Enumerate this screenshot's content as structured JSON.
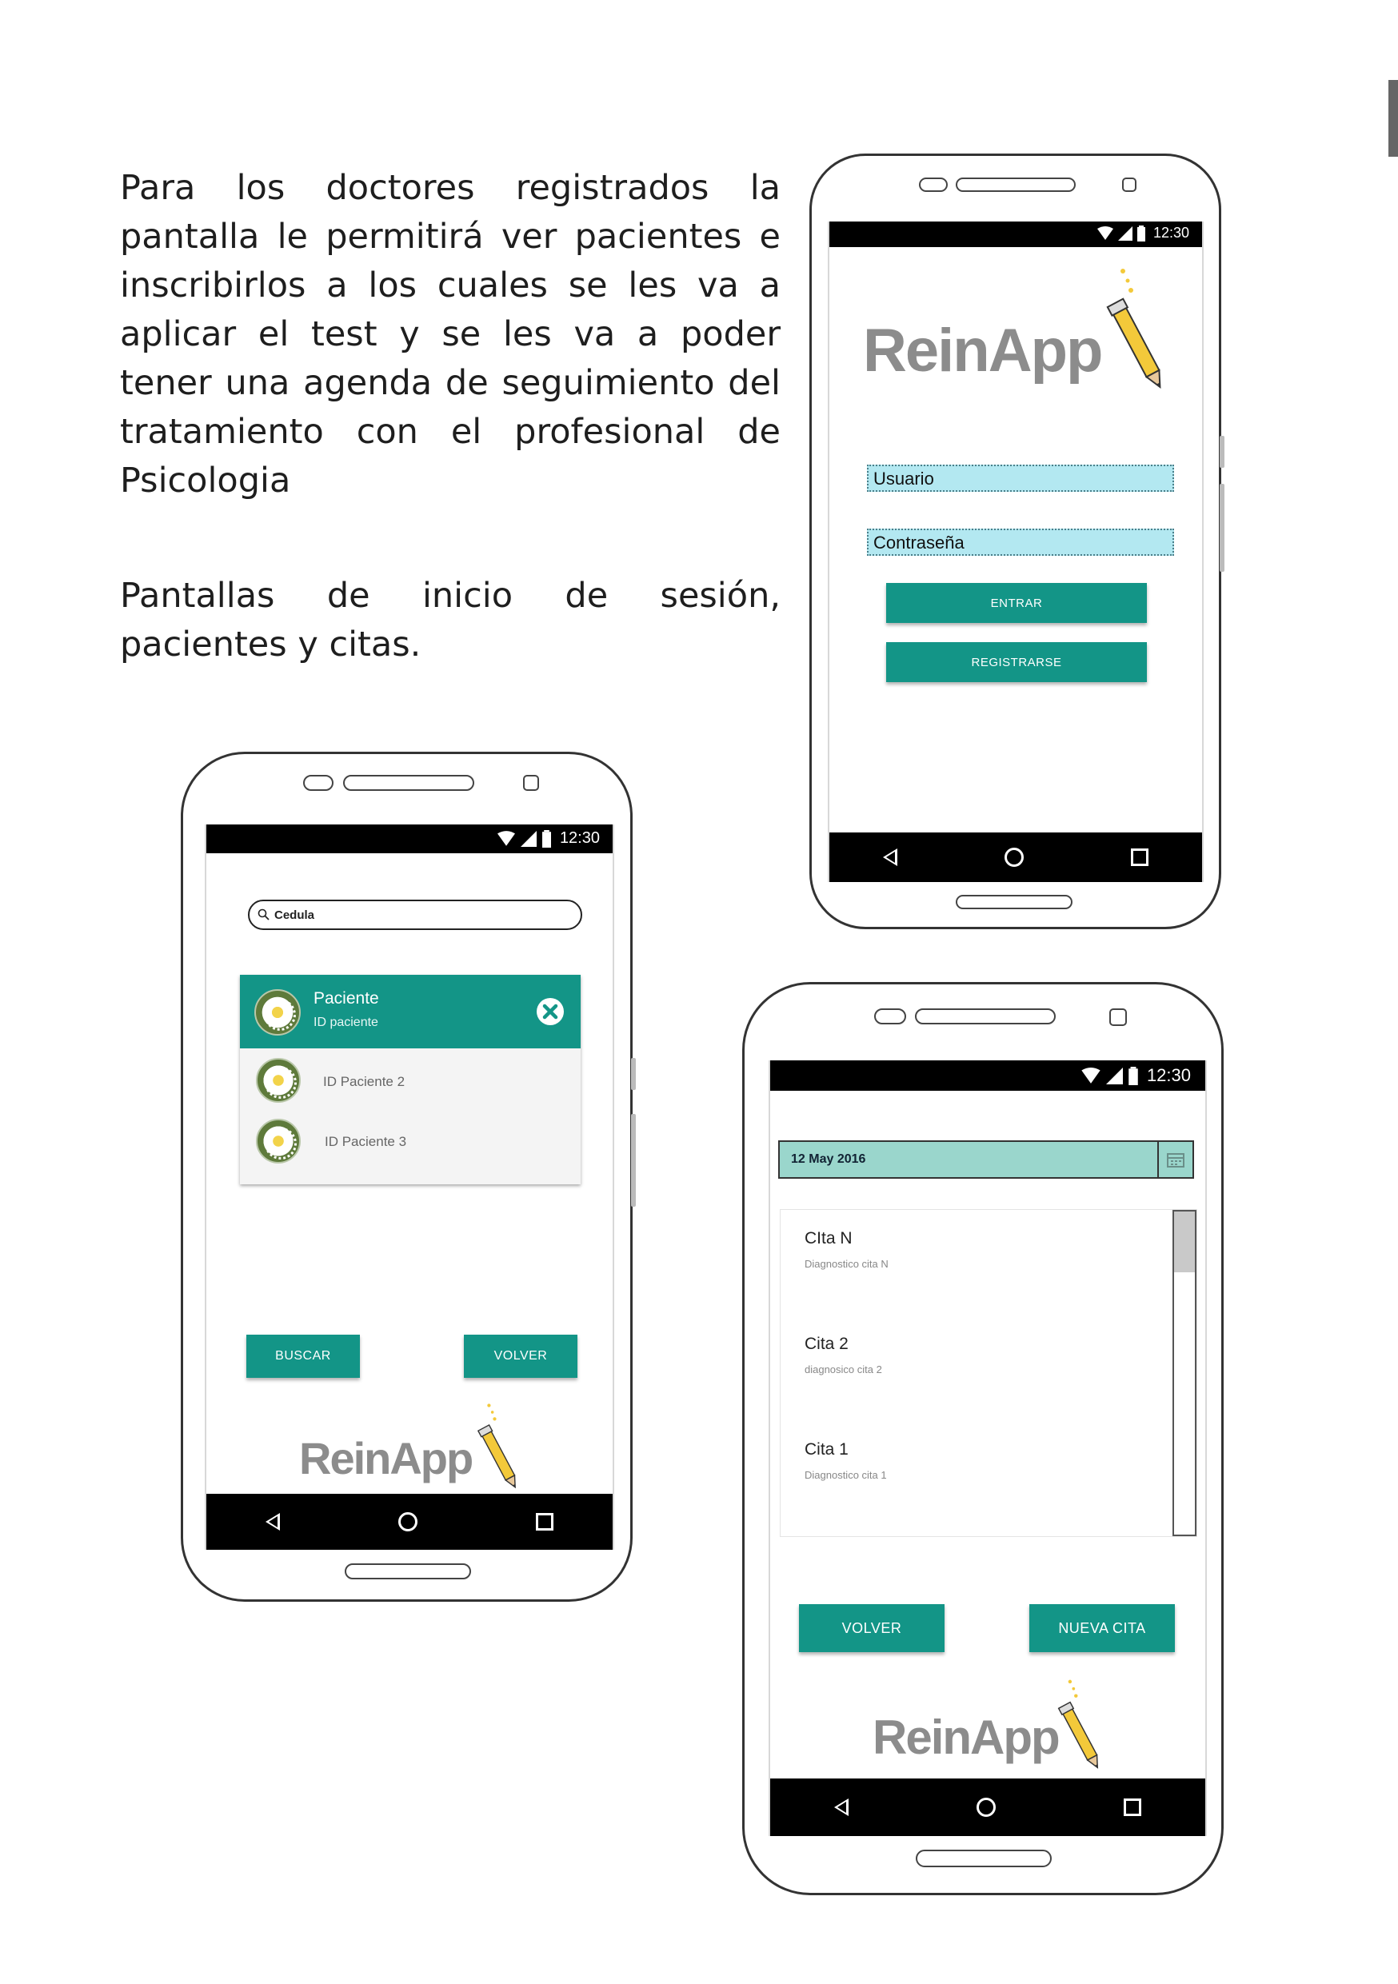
{
  "text": {
    "paragraph_1": "Para los doctores registrados la pantalla le permitirá ver pacientes e inscribirlos a los cuales se les va a aplicar el test y se les va a poder tener una agenda de seguimiento del tratamiento con el profesional de Psicologia",
    "paragraph_2": "Pantallas de inicio de sesión, pacientes y citas."
  },
  "status_bar": {
    "time": "12:30"
  },
  "logo": {
    "text": "ReinApp"
  },
  "login_screen": {
    "username_field": "Usuario",
    "password_field": "Contraseña",
    "enter_button": "ENTRAR",
    "register_button": "REGISTRARSE"
  },
  "patients_screen": {
    "search_placeholder": "Cedula",
    "selected_patient": {
      "name": "Paciente",
      "id": "ID paciente"
    },
    "patients": [
      {
        "id": "ID Paciente 2"
      },
      {
        "id": "ID Paciente 3"
      }
    ],
    "search_button": "BUSCAR",
    "back_button": "VOLVER"
  },
  "appointments_screen": {
    "date": "12 May 2016",
    "appointments": [
      {
        "title": "CIta  N",
        "diagnosis": "Diagnostico cita N"
      },
      {
        "title": "Cita 2",
        "diagnosis": "diagnosico cita 2"
      },
      {
        "title": "Cita 1",
        "diagnosis": "Diagnostico cita 1"
      }
    ],
    "back_button": "VOLVER",
    "new_button": "NUEVA CITA"
  },
  "colors": {
    "teal": "#139587",
    "field_blue": "#b3e8f1",
    "date_field": "#9ad6cc",
    "logo_gray": "#8c8c8c",
    "pencil_yellow": "#f3c93a"
  }
}
